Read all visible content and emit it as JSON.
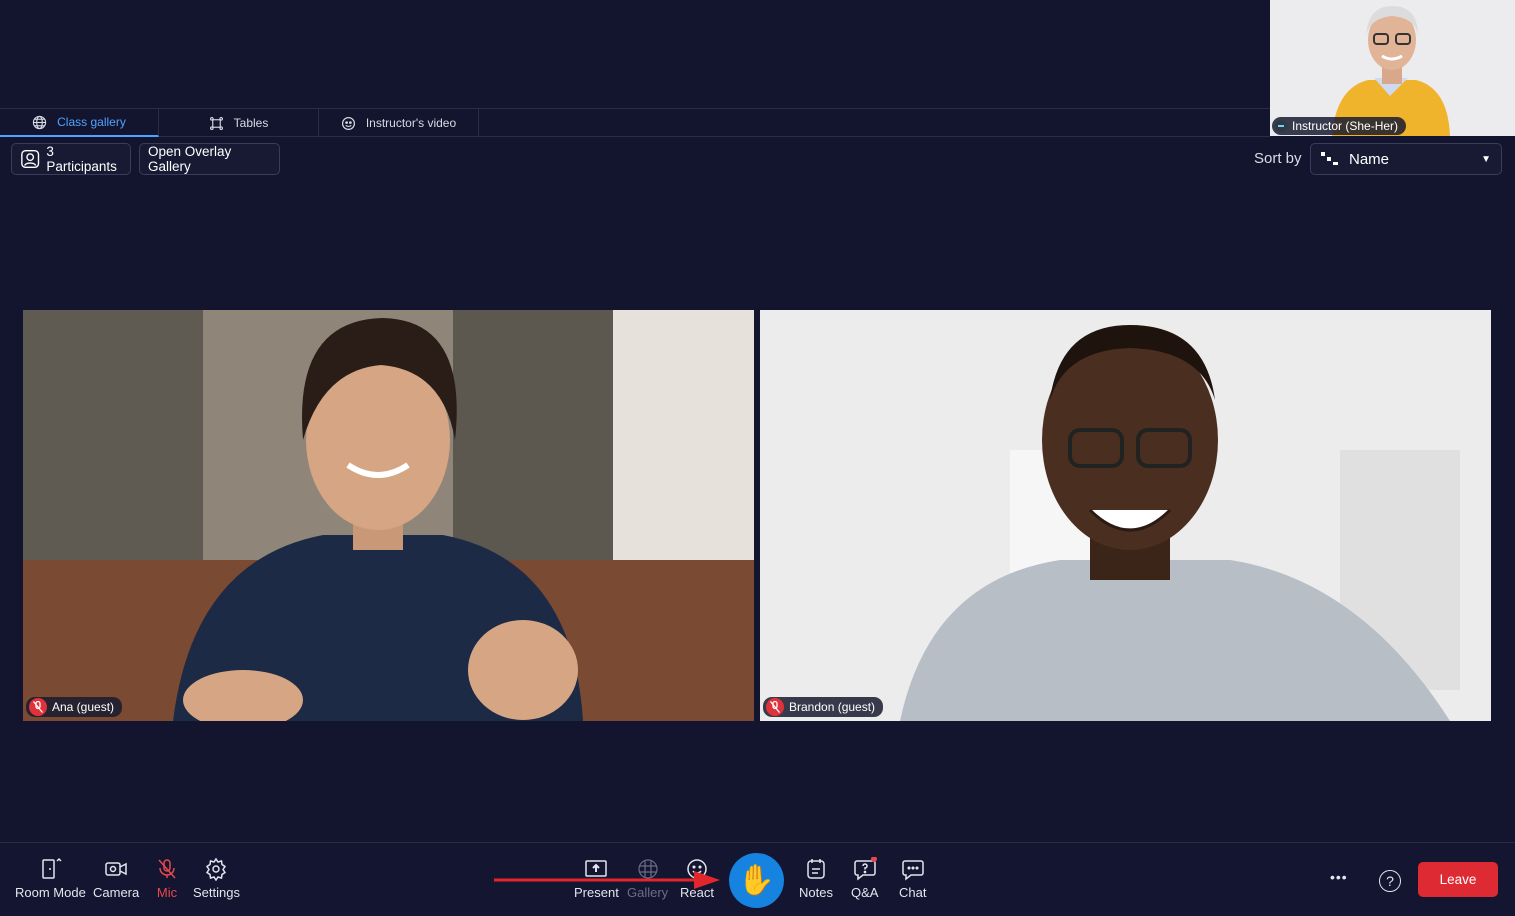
{
  "tabs": [
    {
      "label": "Class gallery",
      "icon": "globe-icon",
      "active": true
    },
    {
      "label": "Tables",
      "icon": "tables-icon",
      "active": false
    },
    {
      "label": "Instructor's video",
      "icon": "video-icon",
      "active": false
    }
  ],
  "instructor": {
    "name": "Instructor (She-Her)"
  },
  "toolbar": {
    "participants_label": "3 Participants",
    "overlay_label": "Open Overlay Gallery",
    "sort_label": "Sort by",
    "sort_value": "Name"
  },
  "participants": [
    {
      "name": "Ana (guest)",
      "muted": true
    },
    {
      "name": "Brandon (guest)",
      "muted": true
    }
  ],
  "controls": {
    "room_mode": "Room Mode",
    "camera": "Camera",
    "mic": "Mic",
    "settings": "Settings",
    "present": "Present",
    "gallery": "Gallery",
    "react": "React",
    "raise_hand": "✋",
    "notes": "Notes",
    "qa": "Q&A",
    "chat": "Chat",
    "more": "•••",
    "help": "?",
    "leave": "Leave"
  },
  "colors": {
    "accent": "#4da3ff",
    "raise_hand": "#1683e0",
    "leave": "#de2a33",
    "muted": "#e0323b",
    "annotation_arrow": "#e3262b"
  }
}
